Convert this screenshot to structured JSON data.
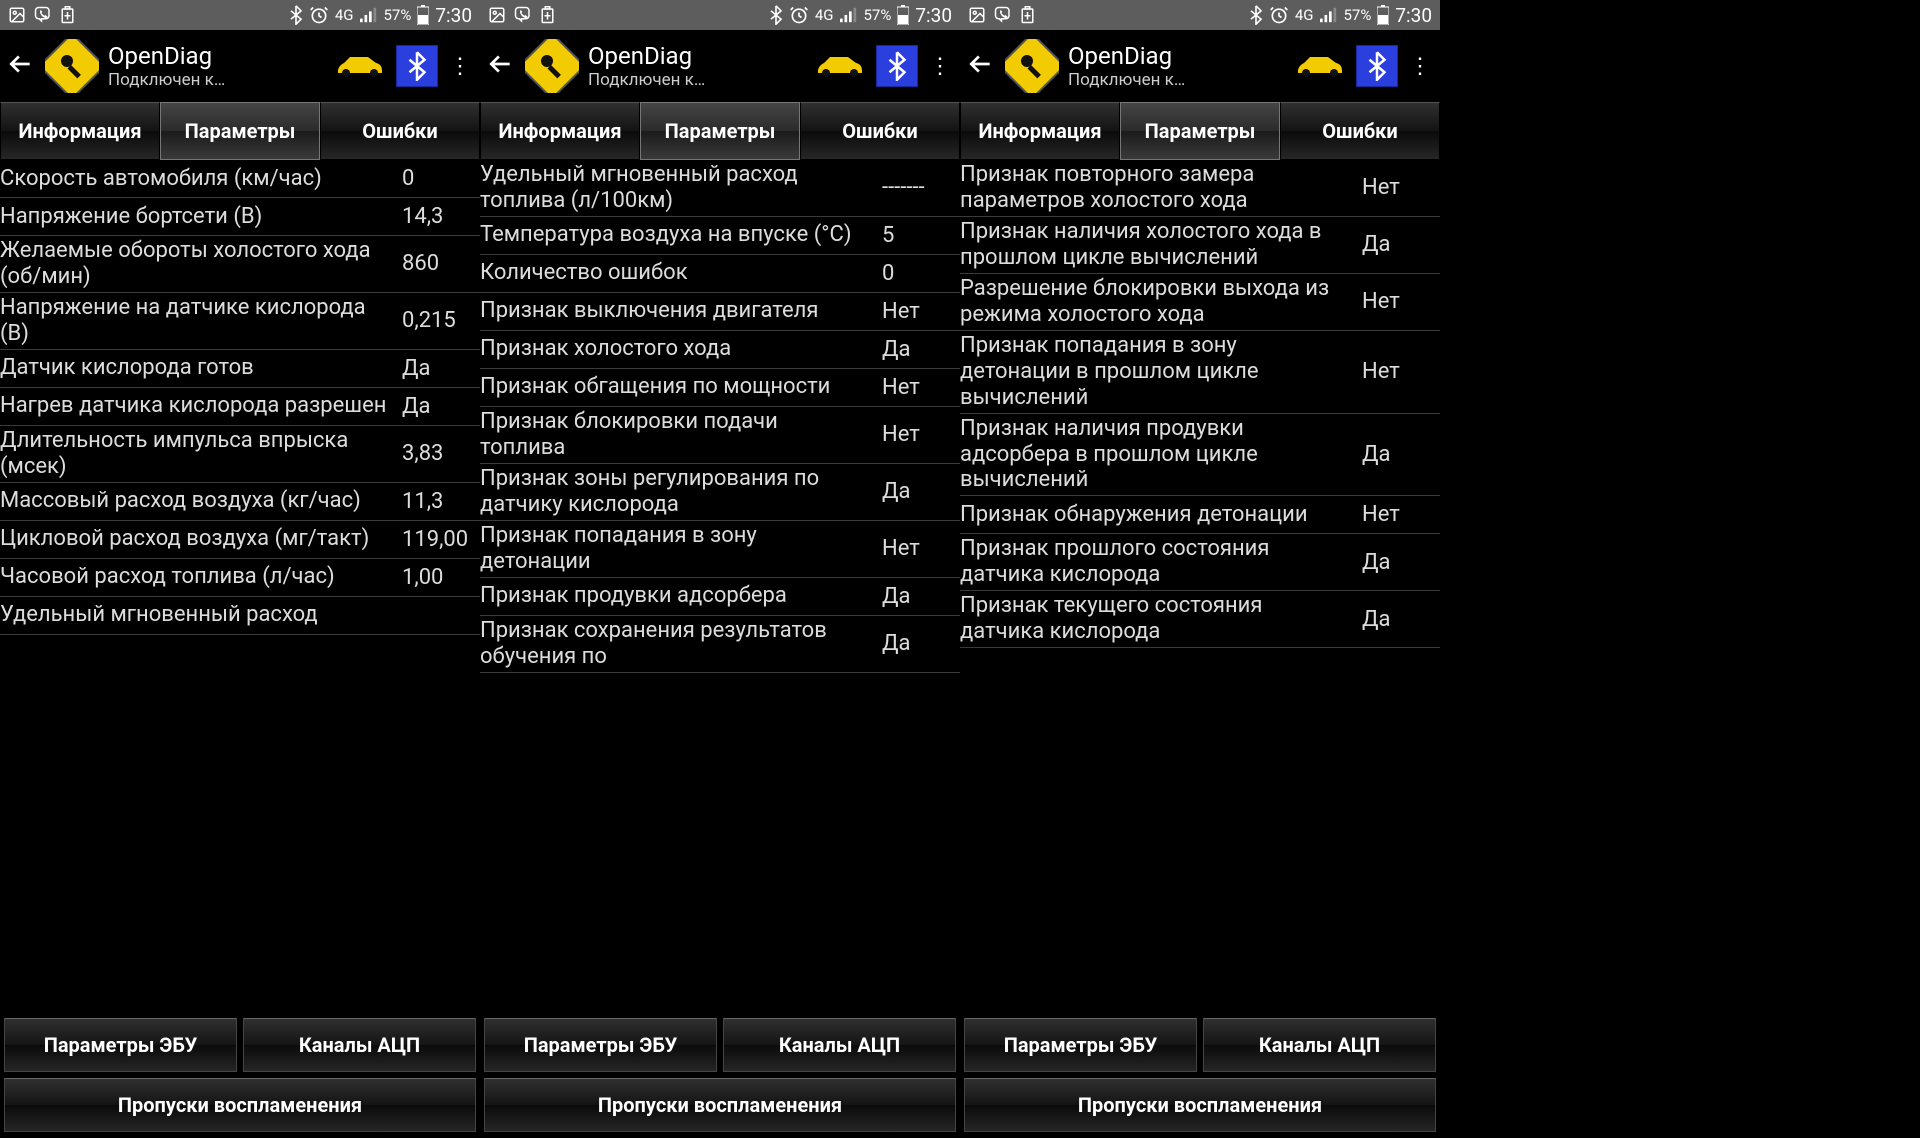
{
  "statusbar": {
    "network_label": "4G",
    "battery_pct": "57%",
    "clock": "7:30"
  },
  "appbar": {
    "title": "OpenDiag",
    "subtitle": "Подключен к…"
  },
  "tabs": {
    "info": "Информация",
    "params": "Параметры",
    "errors": "Ошибки"
  },
  "bottom": {
    "ecu_params": "Параметры ЭБУ",
    "adc_channels": "Каналы АЦП",
    "misfires": "Пропуски воспламенения"
  },
  "panes": [
    {
      "rows": [
        {
          "label": "Скорость автомобиля (км/час)",
          "value": "0"
        },
        {
          "label": "Напряжение бортсети (В)",
          "value": "14,3"
        },
        {
          "label": "Желаемые обороты холостого хода (об/мин)",
          "value": "860"
        },
        {
          "label": "Напряжение на датчике кислорода (В)",
          "value": "0,215"
        },
        {
          "label": "Датчик кислорода готов",
          "value": "Да"
        },
        {
          "label": "Нагрев датчика кислорода разрешен",
          "value": "Да"
        },
        {
          "label": "Длительность импульса впрыска (мсек)",
          "value": "3,83"
        },
        {
          "label": "Массовый расход воздуха (кг/час)",
          "value": "11,3"
        },
        {
          "label": "Цикловой расход воздуха (мг/такт)",
          "value": "119,00"
        },
        {
          "label": "Часовой расход топлива (л/час)",
          "value": "1,00"
        },
        {
          "label": "Удельный мгновенный расход",
          "value": ""
        }
      ]
    },
    {
      "rows": [
        {
          "label": "Удельный мгновенный расход топлива (л/100км)",
          "value": "-------"
        },
        {
          "label": "Температура воздуха на впуске (°C)",
          "value": "5"
        },
        {
          "label": "Количество ошибок",
          "value": "0"
        },
        {
          "label": "Признак выключения двигателя",
          "value": "Нет"
        },
        {
          "label": "Признак холостого хода",
          "value": "Да"
        },
        {
          "label": "Признак обгащения по мощности",
          "value": "Нет"
        },
        {
          "label": "Признак блокировки подачи топлива",
          "value": "Нет"
        },
        {
          "label": "Признак зоны регулирования по датчику кислорода",
          "value": "Да"
        },
        {
          "label": "Признак попадания в зону детонации",
          "value": "Нет"
        },
        {
          "label": "Признак продувки адсорбера",
          "value": "Да"
        },
        {
          "label": "Признак сохранения результатов обучения по",
          "value": "Да"
        }
      ]
    },
    {
      "rows": [
        {
          "label": "Признак повторного замера параметров холостого хода",
          "value": "Нет"
        },
        {
          "label": "Признак наличия холостого хода в прошлом цикле вычислений",
          "value": "Да"
        },
        {
          "label": "Разрешение блокировки выхода из режима холостого хода",
          "value": "Нет"
        },
        {
          "label": "Признак попадания в зону детонации в прошлом цикле вычислений",
          "value": "Нет"
        },
        {
          "label": "Признак наличия продувки адсорбера в прошлом цикле вычислений",
          "value": "Да"
        },
        {
          "label": "Признак обнаружения детонации",
          "value": "Нет"
        },
        {
          "label": "Признак прошлого состояния датчика кислорода",
          "value": "Да"
        },
        {
          "label": "Признак текущего состояния датчика кислорода",
          "value": "Да"
        }
      ]
    }
  ]
}
